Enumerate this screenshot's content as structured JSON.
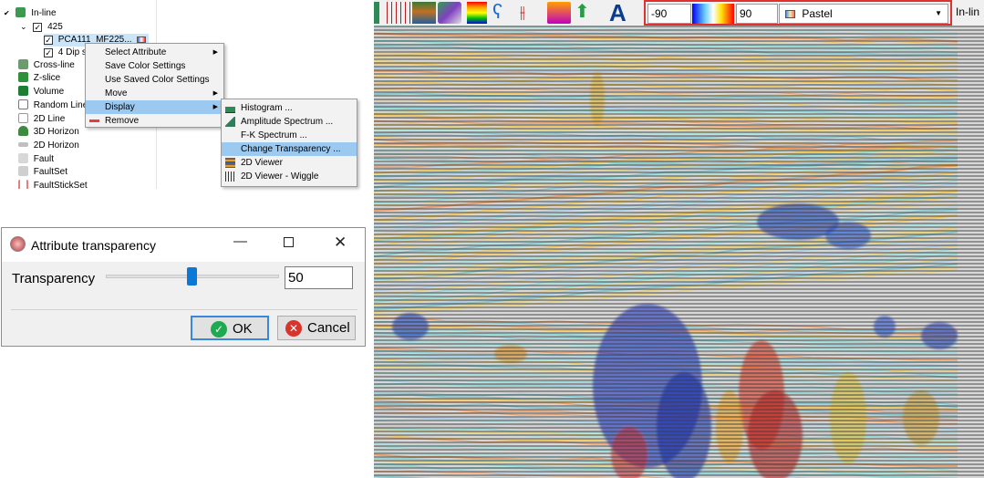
{
  "tree": {
    "items": [
      {
        "label": "In-line",
        "icon": "inline-icon"
      },
      {
        "label": "425",
        "icon": "checkbox"
      },
      {
        "label": "PCA111_MF225...",
        "icon": "checkbox"
      },
      {
        "label": "4 Dip s",
        "icon": "checkbox"
      },
      {
        "label": "Cross-line",
        "icon": "crossline-icon"
      },
      {
        "label": "Z-slice",
        "icon": "zslice-icon"
      },
      {
        "label": "Volume",
        "icon": "volume-icon"
      },
      {
        "label": "Random Line",
        "icon": "randomline-icon"
      },
      {
        "label": "2D Line",
        "icon": "2dline-icon"
      },
      {
        "label": "3D Horizon",
        "icon": "3dhorizon-icon"
      },
      {
        "label": "2D Horizon",
        "icon": "2dhorizon-icon"
      },
      {
        "label": "Fault",
        "icon": "fault-icon"
      },
      {
        "label": "FaultSet",
        "icon": "faultset-icon"
      },
      {
        "label": "FaultStickSet",
        "icon": "faultstickset-icon"
      }
    ]
  },
  "context_menu": {
    "items": [
      {
        "label": "Select Attribute",
        "has_submenu": true
      },
      {
        "label": "Save Color Settings"
      },
      {
        "label": "Use Saved Color Settings"
      },
      {
        "label": "Move",
        "has_submenu": true
      },
      {
        "label": "Display",
        "has_submenu": true,
        "highlighted": true
      },
      {
        "label": "Remove",
        "icon": "remove-icon"
      }
    ]
  },
  "display_submenu": {
    "items": [
      {
        "label": "Histogram ...",
        "icon": "histogram-icon"
      },
      {
        "label": "Amplitude Spectrum ...",
        "icon": "amplitude-spectrum-icon"
      },
      {
        "label": "F-K Spectrum ..."
      },
      {
        "label": "Change Transparency ...",
        "highlighted": true
      },
      {
        "label": "2D Viewer",
        "icon": "2d-viewer-icon"
      },
      {
        "label": "2D Viewer - Wiggle",
        "icon": "wiggle-icon"
      }
    ]
  },
  "dialog": {
    "title": "Attribute transparency",
    "field_label": "Transparency",
    "value": "50",
    "slider_fraction": 0.5,
    "ok_label": "OK",
    "cancel_label": "Cancel"
  },
  "toolbar": {
    "min_value": "-90",
    "max_value": "90",
    "colormap": "Pastel",
    "right_label": "In-lin",
    "highlight_color": "#e03030"
  },
  "colors": {
    "selection": "#9cc9f0",
    "ok_icon": "#1faa52",
    "cancel_icon": "#d9342b"
  }
}
